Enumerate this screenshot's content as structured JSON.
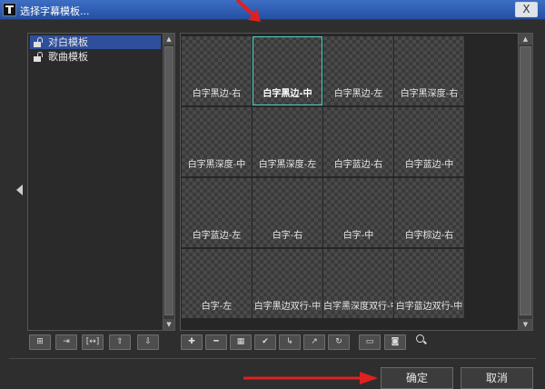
{
  "window": {
    "title": "选择字幕模板...",
    "close_glyph": "X"
  },
  "tree": {
    "items": [
      {
        "label": "对白模板",
        "icon": "unlock-icon",
        "selected": true
      },
      {
        "label": "歌曲模板",
        "icon": "unlock-icon",
        "selected": false
      }
    ]
  },
  "templates": [
    {
      "label": "白字黑边-右",
      "selected": false
    },
    {
      "label": "白字黑边-中",
      "selected": true
    },
    {
      "label": "白字黑边-左",
      "selected": false
    },
    {
      "label": "白字黑深度-右",
      "selected": false
    },
    {
      "label": "白字黑深度-中",
      "selected": false
    },
    {
      "label": "白字黑深度-左",
      "selected": false
    },
    {
      "label": "白字蓝边-右",
      "selected": false
    },
    {
      "label": "白字蓝边-中",
      "selected": false
    },
    {
      "label": "白字蓝边-左",
      "selected": false
    },
    {
      "label": "白字-右",
      "selected": false
    },
    {
      "label": "白字-中",
      "selected": false
    },
    {
      "label": "白字棕边-右",
      "selected": false
    },
    {
      "label": "白字-左",
      "selected": false
    },
    {
      "label": "白字黑边双行-中",
      "selected": false
    },
    {
      "label": "白字黑深度双行-中",
      "selected": false
    },
    {
      "label": "白字蓝边双行-中",
      "selected": false
    }
  ],
  "left_toolbar": {
    "icons": [
      "add-folder-icon",
      "move-folder-icon",
      "rename-icon",
      "move-up-icon",
      "move-down-icon"
    ]
  },
  "right_toolbar": {
    "icons": [
      "add-icon",
      "remove-icon",
      "grid-icon",
      "check-icon",
      "export-icon",
      "share-icon",
      "refresh-icon",
      "monitor-icon",
      "snapshot-icon"
    ]
  },
  "buttons": {
    "ok": "确定",
    "cancel": "取消"
  },
  "colors": {
    "titlebar": "#2d5cb0",
    "selection": "#2f4f9c",
    "selected_cell_border": "#4fd3c6",
    "annotation_arrow": "#e02020"
  }
}
